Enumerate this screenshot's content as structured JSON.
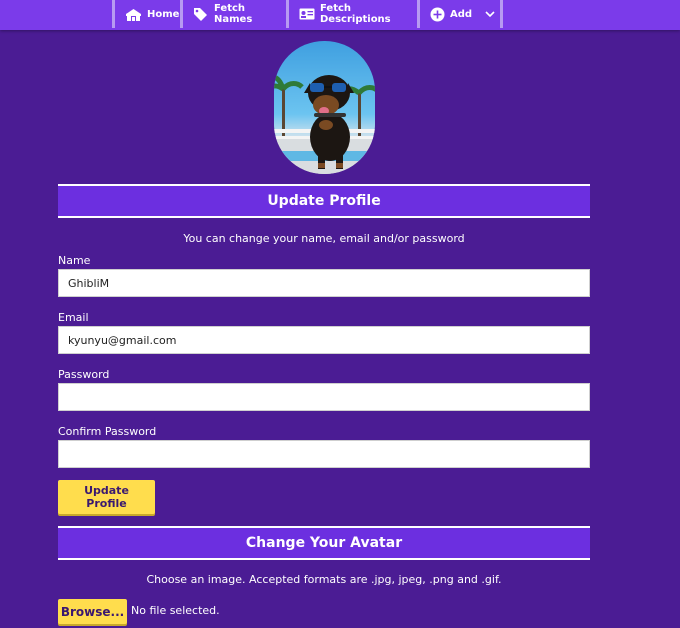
{
  "nav": {
    "items": [
      {
        "label": "Home",
        "icon": "home-icon"
      },
      {
        "label": "Fetch Names",
        "icon": "tags-icon"
      },
      {
        "label": "Fetch Descriptions",
        "icon": "id-card-icon"
      },
      {
        "label": "Add",
        "icon": "plus-circle-icon",
        "dropdown_icon": "chevron-down-icon"
      }
    ]
  },
  "profile": {
    "avatar_alt": "dog-with-sunglasses-avatar",
    "title": "Update Profile",
    "hint": "You can change your name, email and/or password",
    "fields": {
      "name": {
        "label": "Name",
        "value": "GhibliM"
      },
      "email": {
        "label": "Email",
        "value": "kyunyu@gmail.com"
      },
      "password": {
        "label": "Password",
        "value": ""
      },
      "confirm_password": {
        "label": "Confirm Password",
        "value": ""
      }
    },
    "submit_label": "Update Profile"
  },
  "avatar_section": {
    "title": "Change Your Avatar",
    "hint": "Choose an image. Accepted formats are .jpg, jpeg, .png and .gif.",
    "browse_label": "Browse...",
    "file_status": "No file selected."
  },
  "colors": {
    "background": "#4b1c94",
    "nav": "#7b3bea",
    "header_band": "#6c2fe0",
    "button": "#ffdd4d"
  }
}
